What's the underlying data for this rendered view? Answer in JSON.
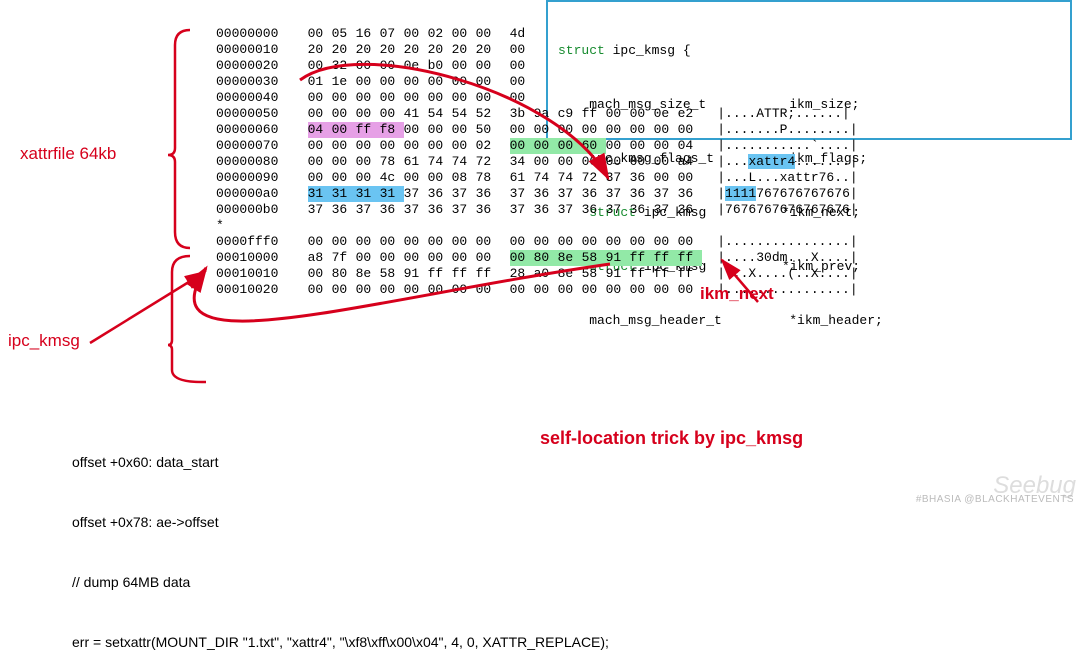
{
  "labels": {
    "xattrfile": "xattrfile 64kb",
    "ipc_kmsg": "ipc_kmsg",
    "ikm_next": "ikm_next",
    "trick": "self-location trick by ipc_kmsg"
  },
  "notes": {
    "l1": "offset +0x60: data_start",
    "l2": "offset +0x78: ae->offset",
    "l3": "// dump 64MB data",
    "l4": "err = setxattr(MOUNT_DIR \"1.txt\", \"xattr4\", \"\\xf8\\xff\\x00\\x04\", 4, 0, XATTR_REPLACE);"
  },
  "struct": {
    "l1_kw": "struct",
    "l1_rest": " ipc_kmsg {",
    "r1_type": "mach_msg_size_t",
    "r1_field": "ikm_size;",
    "r2_type": "ipc_kmsg_flags_t",
    "r2_field": "ikm_flags;",
    "r3_kw": "struct",
    "r3_type": " ipc_kmsg",
    "r3_field": "*ikm_next;",
    "r4_kw": "struct",
    "r4_type": " ipc_kmsg",
    "r4_field": "*ikm_prev;",
    "r5_type": "mach_msg_header_t",
    "r5_field": "*ikm_header;"
  },
  "hex_rows": [
    {
      "offset": "00000000",
      "b1": [
        "00",
        "05",
        "16",
        "07",
        "00",
        "02",
        "00",
        "00"
      ],
      "b2": [
        "4d",
        "",
        "",
        "",
        "",
        "",
        "",
        ""
      ],
      "asc": ""
    },
    {
      "offset": "00000010",
      "b1": [
        "20",
        "20",
        "20",
        "20",
        "20",
        "20",
        "20",
        "20"
      ],
      "b2": [
        "00",
        "",
        "",
        "",
        "",
        "",
        "",
        ""
      ],
      "asc": ""
    },
    {
      "offset": "00000020",
      "b1": [
        "00",
        "32",
        "00",
        "00",
        "0e",
        "b0",
        "00",
        "00"
      ],
      "b2": [
        "00",
        "",
        "",
        "",
        "",
        "",
        "",
        ""
      ],
      "asc": ""
    },
    {
      "offset": "00000030",
      "b1": [
        "01",
        "1e",
        "00",
        "00",
        "00",
        "00",
        "00",
        "00"
      ],
      "b2": [
        "00",
        "",
        "",
        "",
        "",
        "",
        "",
        ""
      ],
      "asc": ""
    },
    {
      "offset": "00000040",
      "b1": [
        "00",
        "00",
        "00",
        "00",
        "00",
        "00",
        "00",
        "00"
      ],
      "b2": [
        "00",
        "",
        "",
        "",
        "",
        "",
        "",
        ""
      ],
      "asc": ""
    },
    {
      "offset": "00000050",
      "b1": [
        "00",
        "00",
        "00",
        "00",
        "41",
        "54",
        "54",
        "52"
      ],
      "b2": [
        "3b",
        "9a",
        "c9",
        "ff",
        "00",
        "00",
        "0e",
        "e2"
      ],
      "asc": "|....ATTR;......|"
    },
    {
      "offset": "00000060",
      "b1": [
        "04",
        "00",
        "ff",
        "f8",
        "00",
        "00",
        "00",
        "50"
      ],
      "b2": [
        "00",
        "00",
        "00",
        "00",
        "00",
        "00",
        "00",
        "00"
      ],
      "asc": "|.......P........|",
      "hl1": {
        "s": 0,
        "e": 3,
        "cls": "hl-violet"
      }
    },
    {
      "offset": "00000070",
      "b1": [
        "00",
        "00",
        "00",
        "00",
        "00",
        "00",
        "00",
        "02"
      ],
      "b2": [
        "00",
        "00",
        "00",
        "60",
        "00",
        "00",
        "00",
        "04"
      ],
      "asc": "|...........`....|",
      "hl2": {
        "s": 0,
        "e": 3,
        "cls": "hl-green"
      }
    },
    {
      "offset": "00000080",
      "b1": [
        "00",
        "00",
        "00",
        "78",
        "61",
        "74",
        "74",
        "72"
      ],
      "b2": [
        "34",
        "00",
        "00",
        "00",
        "00",
        "00",
        "00",
        "a4"
      ],
      "asc": "|...xattr4.......|",
      "asc_hl": {
        "s": 4,
        "e": 9,
        "cls": "hl-blue"
      }
    },
    {
      "offset": "00000090",
      "b1": [
        "00",
        "00",
        "00",
        "4c",
        "00",
        "00",
        "08",
        "78"
      ],
      "b2": [
        "61",
        "74",
        "74",
        "72",
        "37",
        "36",
        "00",
        "00"
      ],
      "asc": "|...L...xattr76..|"
    },
    {
      "offset": "000000a0",
      "b1": [
        "31",
        "31",
        "31",
        "31",
        "37",
        "36",
        "37",
        "36"
      ],
      "b2": [
        "37",
        "36",
        "37",
        "36",
        "37",
        "36",
        "37",
        "36"
      ],
      "asc": "|1111767676767676|",
      "hl1": {
        "s": 0,
        "e": 3,
        "cls": "hl-blue2"
      },
      "asc_hl": {
        "s": 1,
        "e": 4,
        "cls": "hl-blue2"
      }
    },
    {
      "offset": "000000b0",
      "b1": [
        "37",
        "36",
        "37",
        "36",
        "37",
        "36",
        "37",
        "36"
      ],
      "b2": [
        "37",
        "36",
        "37",
        "36",
        "37",
        "36",
        "37",
        "36"
      ],
      "asc": "|7676767676767676|"
    },
    {
      "offset": "*",
      "b1": [
        "",
        "",
        "",
        "",
        "",
        "",
        "",
        ""
      ],
      "b2": [
        "",
        "",
        "",
        "",
        "",
        "",
        "",
        ""
      ],
      "asc": ""
    },
    {
      "offset": "0000fff0",
      "b1": [
        "00",
        "00",
        "00",
        "00",
        "00",
        "00",
        "00",
        "00"
      ],
      "b2": [
        "00",
        "00",
        "00",
        "00",
        "00",
        "00",
        "00",
        "00"
      ],
      "asc": "|................|"
    },
    {
      "offset": "00010000",
      "b1": [
        "a8",
        "7f",
        "00",
        "00",
        "00",
        "00",
        "00",
        "00"
      ],
      "b2": [
        "00",
        "80",
        "8e",
        "58",
        "91",
        "ff",
        "ff",
        "ff"
      ],
      "asc": "|....30dm...X....|",
      "hl2": {
        "s": 0,
        "e": 7,
        "cls": "hl-green"
      }
    },
    {
      "offset": "00010010",
      "b1": [
        "00",
        "80",
        "8e",
        "58",
        "91",
        "ff",
        "ff",
        "ff"
      ],
      "b2": [
        "28",
        "a0",
        "8e",
        "58",
        "91",
        "ff",
        "ff",
        "ff"
      ],
      "asc": "|...X....(..X....|"
    },
    {
      "offset": "00010020",
      "b1": [
        "00",
        "00",
        "00",
        "00",
        "00",
        "00",
        "00",
        "00"
      ],
      "b2": [
        "00",
        "00",
        "00",
        "00",
        "00",
        "00",
        "00",
        "00"
      ],
      "asc": "|................|"
    }
  ],
  "watermark": {
    "seebug": "Seebug",
    "tag": "#BHASIA  @BLACKHATEVENTS"
  }
}
